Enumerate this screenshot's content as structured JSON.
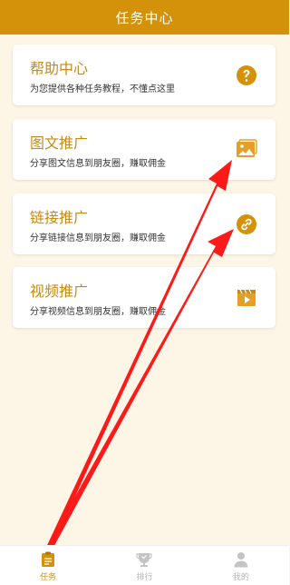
{
  "header": {
    "title": "任务中心"
  },
  "cards": [
    {
      "title": "帮助中心",
      "desc": "为您提供各种任务教程，不懂点这里",
      "icon": "question-icon"
    },
    {
      "title": "图文推广",
      "desc": "分享图文信息到朋友圈，赚取佣金",
      "icon": "image-icon"
    },
    {
      "title": "链接推广",
      "desc": "分享链接信息到朋友圈，赚取佣金",
      "icon": "link-icon"
    },
    {
      "title": "视频推广",
      "desc": "分享视频信息到朋友圈，赚取佣金",
      "icon": "video-icon"
    }
  ],
  "tabs": [
    {
      "label": "任务",
      "icon": "task-icon",
      "active": true
    },
    {
      "label": "排行",
      "icon": "ranking-icon",
      "active": false
    },
    {
      "label": "我的",
      "icon": "profile-icon",
      "active": false
    }
  ],
  "colors": {
    "accent": "#d4920b",
    "background": "#fdf5e6",
    "annotation": "#ff1a1a"
  }
}
